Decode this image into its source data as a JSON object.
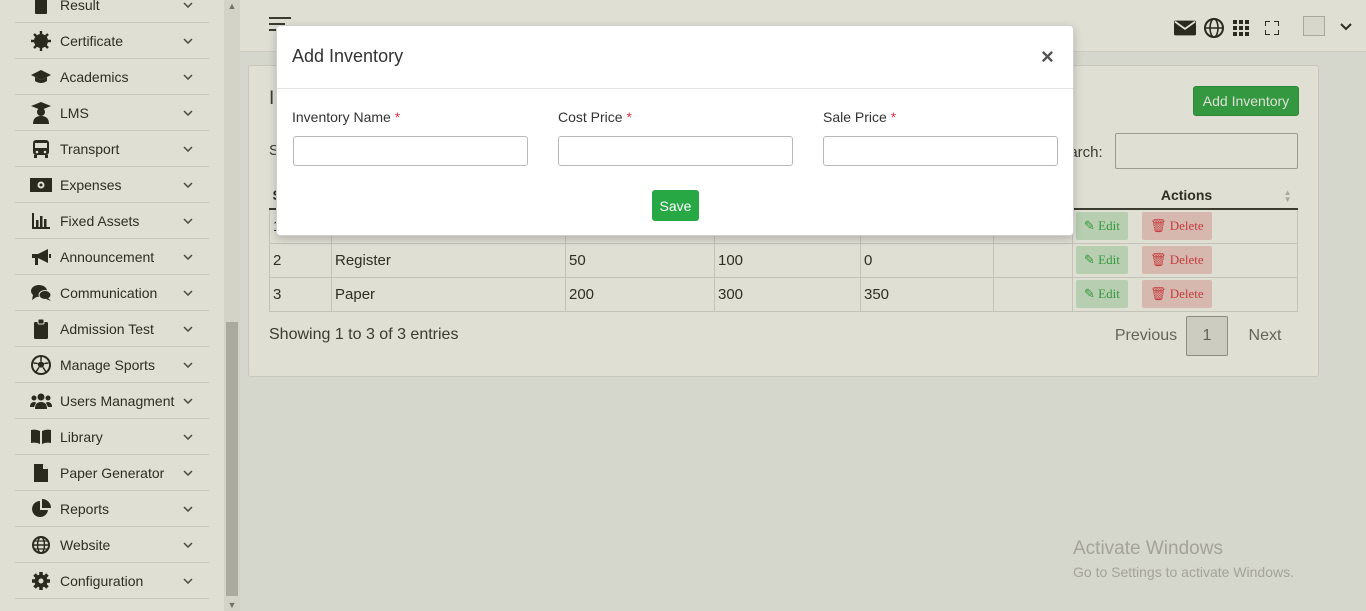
{
  "sidebar": {
    "items": [
      {
        "label": "Result",
        "icon": "document-icon"
      },
      {
        "label": "Certificate",
        "icon": "certificate-icon"
      },
      {
        "label": "Academics",
        "icon": "graduation-cap-icon"
      },
      {
        "label": "LMS",
        "icon": "student-icon"
      },
      {
        "label": "Transport",
        "icon": "bus-icon"
      },
      {
        "label": "Expenses",
        "icon": "money-bill-icon"
      },
      {
        "label": "Fixed Assets",
        "icon": "bar-chart-icon"
      },
      {
        "label": "Announcement",
        "icon": "megaphone-icon"
      },
      {
        "label": "Communication",
        "icon": "comments-icon"
      },
      {
        "label": "Admission Test",
        "icon": "clipboard-icon"
      },
      {
        "label": "Manage Sports",
        "icon": "soccer-ball-icon"
      },
      {
        "label": "Users Managment",
        "icon": "users-icon"
      },
      {
        "label": "Library",
        "icon": "book-icon"
      },
      {
        "label": "Paper Generator",
        "icon": "file-icon"
      },
      {
        "label": "Reports",
        "icon": "pie-chart-icon"
      },
      {
        "label": "Website",
        "icon": "globe-icon"
      },
      {
        "label": "Configuration",
        "icon": "cog-icon"
      }
    ]
  },
  "topbar": {
    "icons": [
      "envelope-icon",
      "globe-icon",
      "grid-icon",
      "fullscreen-icon"
    ]
  },
  "page": {
    "title": "I",
    "add_button": "Add Inventory",
    "show_label": "S",
    "search_label": "earch:",
    "table": {
      "headers": [
        "S",
        "",
        "",
        "",
        "",
        "",
        "Actions"
      ],
      "rows": [
        {
          "no": "1",
          "name": "",
          "cost": "",
          "sale": "",
          "qty": ""
        },
        {
          "no": "2",
          "name": "Register",
          "cost": "50",
          "sale": "100",
          "qty": "0"
        },
        {
          "no": "3",
          "name": "Paper",
          "cost": "200",
          "sale": "300",
          "qty": "350"
        }
      ],
      "edit_label": "Edit",
      "delete_label": "Delete"
    },
    "info": "Showing 1 to 3 of 3 entries",
    "pagination": {
      "previous": "Previous",
      "current": "1",
      "next": "Next"
    }
  },
  "watermark": {
    "line1": "Activate Windows",
    "line2": "Go to Settings to activate Windows."
  },
  "modal": {
    "title": "Add Inventory",
    "close": "×",
    "fields": [
      {
        "label": "Inventory Name",
        "required": "*",
        "value": ""
      },
      {
        "label": "Cost Price",
        "required": "*",
        "value": ""
      },
      {
        "label": "Sale Price",
        "required": "*",
        "value": ""
      }
    ],
    "save": "Save"
  },
  "colors": {
    "accent_green": "#28a745",
    "danger_red": "#dc3545"
  }
}
